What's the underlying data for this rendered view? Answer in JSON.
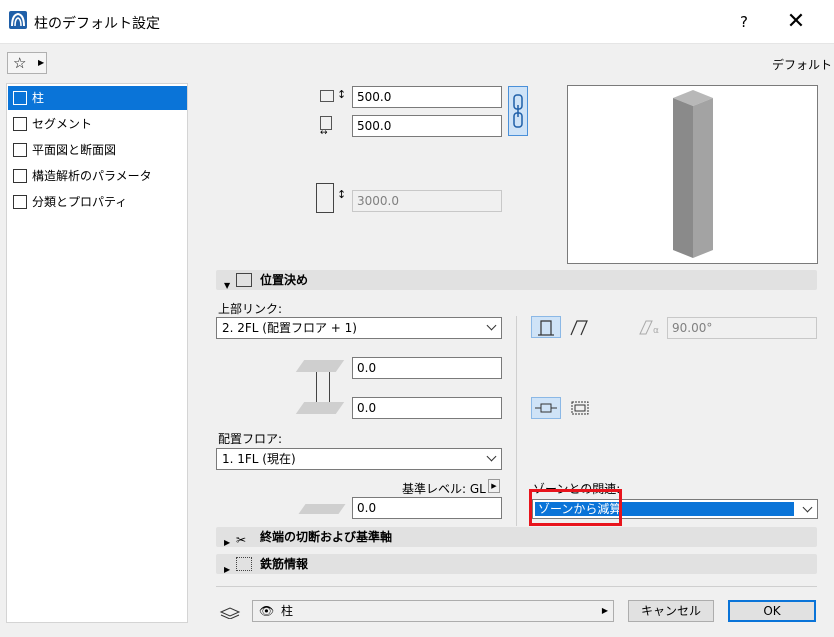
{
  "window": {
    "title": "柱のデフォルト設定",
    "help_label": "?",
    "close_label": "✕"
  },
  "toolbar": {
    "favorites_icon": "star-icon",
    "favorites_label": "☆",
    "default_label": "デフォルト"
  },
  "sidebar": {
    "items": [
      {
        "label": "柱",
        "icon": "column-icon",
        "selected": true
      },
      {
        "label": "セグメント",
        "icon": "segment-icon",
        "selected": false
      },
      {
        "label": "平面図と断面図",
        "icon": "floorplan-icon",
        "selected": false
      },
      {
        "label": "構造解析のパラメータ",
        "icon": "structure-icon",
        "selected": false
      },
      {
        "label": "分類とプロパティ",
        "icon": "classification-icon",
        "selected": false
      }
    ]
  },
  "geometry": {
    "width_value": "500.0",
    "depth_value": "500.0",
    "height_value": "3000.0"
  },
  "positioning": {
    "header": "位置決め",
    "top_link_label": "上部リンク:",
    "top_link_value": "2. 2FL (配置フロア + 1)",
    "top_offset_value": "0.0",
    "bottom_offset_value": "0.0",
    "home_story_label": "配置フロア:",
    "home_story_value": "1. 1FL (現在)",
    "reference_level_label": "基準レベル: GL",
    "reference_offset_value": "0.0",
    "slant_angle_value": "90.00°",
    "zone_relation_label": "ゾーンとの関連:",
    "zone_relation_value": "ゾーンから減算"
  },
  "sections": {
    "end_cuts": "終端の切断および基準軸",
    "reinforcement": "鉄筋情報"
  },
  "footer": {
    "layer_value": "柱",
    "cancel_label": "キャンセル",
    "ok_label": "OK"
  },
  "colors": {
    "accent": "#0a74d8",
    "highlight": "#e8141c"
  }
}
